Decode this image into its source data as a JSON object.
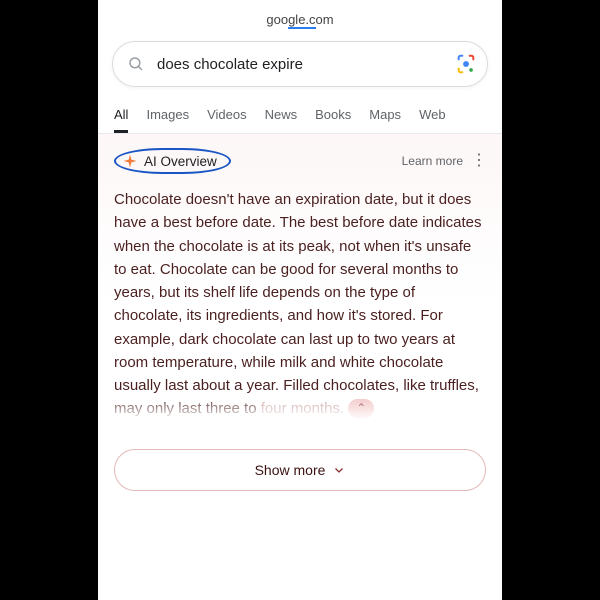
{
  "url": "google.com",
  "search": {
    "query": "does chocolate expire"
  },
  "tabs": {
    "items": [
      "All",
      "Images",
      "Videos",
      "News",
      "Books",
      "Maps",
      "Web"
    ],
    "active": "All"
  },
  "ai_overview": {
    "title": "AI Overview",
    "learn_more": "Learn more",
    "body_main": "Chocolate doesn't have an expiration date, but it does have a best before date. The best before date indicates when the chocolate is at its peak, not when it's unsafe to eat. Chocolate can be good for several months to years, but its shelf life depends on the type of chocolate, its ingredients, and how it's stored. For example, dark chocolate can last up to two years at room temperature, while milk and white chocolate usually last about a year. Filled chocolates, like truffles, may only last three to ",
    "body_trailing": "four months.",
    "inline_badge": "⌃"
  },
  "show_more": "Show more"
}
